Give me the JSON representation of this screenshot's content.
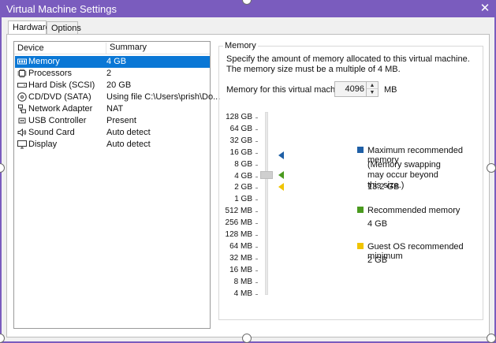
{
  "window": {
    "title": "Virtual Machine Settings",
    "close_icon": "close-icon"
  },
  "tabs": [
    {
      "label": "Hardware"
    },
    {
      "label": "Options"
    }
  ],
  "device_list": {
    "headers": {
      "device": "Device",
      "summary": "Summary"
    },
    "rows": [
      {
        "name": "Memory",
        "summary": "4 GB",
        "icon": "memory-icon",
        "selected": true
      },
      {
        "name": "Processors",
        "summary": "2",
        "icon": "processor-icon"
      },
      {
        "name": "Hard Disk (SCSI)",
        "summary": "20 GB",
        "icon": "hard-disk-icon"
      },
      {
        "name": "CD/DVD (SATA)",
        "summary": "Using file C:\\Users\\prish\\Do...",
        "icon": "cd-dvd-icon"
      },
      {
        "name": "Network Adapter",
        "summary": "NAT",
        "icon": "network-adapter-icon"
      },
      {
        "name": "USB Controller",
        "summary": "Present",
        "icon": "usb-controller-icon"
      },
      {
        "name": "Sound Card",
        "summary": "Auto detect",
        "icon": "sound-card-icon"
      },
      {
        "name": "Display",
        "summary": "Auto detect",
        "icon": "display-icon"
      }
    ]
  },
  "memory": {
    "group_title": "Memory",
    "description": "Specify the amount of memory allocated to this virtual machine. The memory size must be a multiple of 4 MB.",
    "input_label": "Memory for this virtual machine:",
    "value": "4096",
    "unit": "MB",
    "scale_labels": [
      "128 GB",
      "64 GB",
      "32 GB",
      "16 GB",
      "8 GB",
      "4 GB",
      "2 GB",
      "1 GB",
      "512 MB",
      "256 MB",
      "128 MB",
      "64 MB",
      "32 MB",
      "16 MB",
      "8 MB",
      "4 MB"
    ],
    "slider_value": "4 GB",
    "legend": {
      "max": {
        "title": "Maximum recommended memory",
        "note": "(Memory swapping may occur beyond this size.)",
        "value": "13.2 GB",
        "color": "#1f5fa6"
      },
      "recommended": {
        "title": "Recommended memory",
        "value": "4 GB",
        "color": "#4a9a1e"
      },
      "guest_min": {
        "title": "Guest OS recommended minimum",
        "value": "2 GB",
        "color": "#f0c400"
      }
    }
  }
}
